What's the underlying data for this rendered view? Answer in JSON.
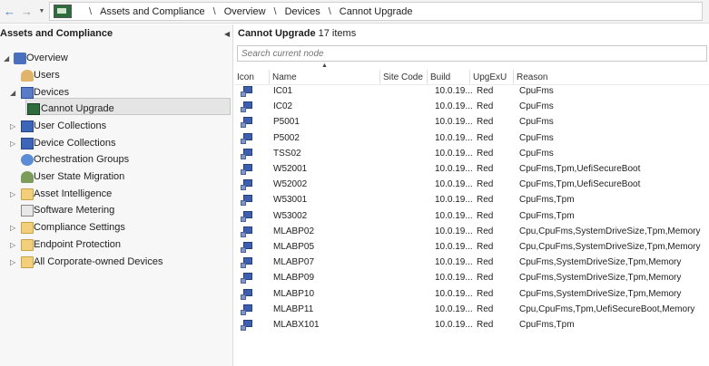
{
  "nav": {
    "back_label": "←",
    "forward_label": "→",
    "dropdown_label": "▼",
    "separator": "\\",
    "breadcrumb": [
      "Assets and Compliance",
      "Overview",
      "Devices",
      "Cannot Upgrade"
    ]
  },
  "left": {
    "title": "Assets and Compliance",
    "collapse_glyph": "◀",
    "tree": [
      {
        "label": "Overview",
        "icon": "overview-icon",
        "expander": "◢"
      },
      {
        "label": "Users",
        "icon": "users-icon",
        "expander": ""
      },
      {
        "label": "Devices",
        "icon": "devices-icon",
        "expander": "◢"
      },
      {
        "label": "Cannot Upgrade",
        "icon": "monitor-icon",
        "expander": ""
      },
      {
        "label": "User Collections",
        "icon": "user-collections-icon",
        "expander": "▷"
      },
      {
        "label": "Device Collections",
        "icon": "device-collections-icon",
        "expander": "▷"
      },
      {
        "label": "Orchestration Groups",
        "icon": "orchestration-icon",
        "expander": ""
      },
      {
        "label": "User State Migration",
        "icon": "user-state-icon",
        "expander": ""
      },
      {
        "label": "Asset Intelligence",
        "icon": "folder-icon",
        "expander": "▷"
      },
      {
        "label": "Software Metering",
        "icon": "metering-icon",
        "expander": ""
      },
      {
        "label": "Compliance Settings",
        "icon": "folder-icon",
        "expander": "▷"
      },
      {
        "label": "Endpoint Protection",
        "icon": "folder-icon",
        "expander": "▷"
      },
      {
        "label": "All Corporate-owned Devices",
        "icon": "folder-icon",
        "expander": "▷"
      }
    ]
  },
  "right": {
    "title": "Cannot Upgrade",
    "count": "17 items",
    "search_placeholder": "Search current node",
    "sort_glyph": "▲",
    "columns": [
      "Icon",
      "Name",
      "Site Code",
      "Build",
      "UpgExU",
      "Reason"
    ],
    "rows": [
      {
        "name": "IC01",
        "build": "10.0.19...",
        "upg": "Red",
        "reason": "CpuFms"
      },
      {
        "name": "IC02",
        "build": "10.0.19...",
        "upg": "Red",
        "reason": "CpuFms"
      },
      {
        "name": "P5001",
        "build": "10.0.19...",
        "upg": "Red",
        "reason": "CpuFms"
      },
      {
        "name": "P5002",
        "build": "10.0.19...",
        "upg": "Red",
        "reason": "CpuFms"
      },
      {
        "name": "TSS02",
        "build": "10.0.19...",
        "upg": "Red",
        "reason": "CpuFms"
      },
      {
        "name": "W52001",
        "build": "10.0.19...",
        "upg": "Red",
        "reason": "CpuFms,Tpm,UefiSecureBoot"
      },
      {
        "name": "W52002",
        "build": "10.0.19...",
        "upg": "Red",
        "reason": "CpuFms,Tpm,UefiSecureBoot"
      },
      {
        "name": "W53001",
        "build": "10.0.19...",
        "upg": "Red",
        "reason": "CpuFms,Tpm"
      },
      {
        "name": "W53002",
        "build": "10.0.19...",
        "upg": "Red",
        "reason": "CpuFms,Tpm"
      },
      {
        "name": "MLABP02",
        "build": "10.0.19...",
        "upg": "Red",
        "reason": "Cpu,CpuFms,SystemDriveSize,Tpm,Memory"
      },
      {
        "name": "MLABP05",
        "build": "10.0.19...",
        "upg": "Red",
        "reason": "Cpu,CpuFms,SystemDriveSize,Tpm,Memory"
      },
      {
        "name": "MLABP07",
        "build": "10.0.19...",
        "upg": "Red",
        "reason": "CpuFms,SystemDriveSize,Tpm,Memory"
      },
      {
        "name": "MLABP09",
        "build": "10.0.19...",
        "upg": "Red",
        "reason": "CpuFms,SystemDriveSize,Tpm,Memory"
      },
      {
        "name": "MLABP10",
        "build": "10.0.19...",
        "upg": "Red",
        "reason": "CpuFms,SystemDriveSize,Tpm,Memory"
      },
      {
        "name": "MLABP11",
        "build": "10.0.19...",
        "upg": "Red",
        "reason": "Cpu,CpuFms,Tpm,UefiSecureBoot,Memory"
      },
      {
        "name": "MLABX101",
        "build": "10.0.19...",
        "upg": "Red",
        "reason": "CpuFms,Tpm"
      }
    ]
  }
}
